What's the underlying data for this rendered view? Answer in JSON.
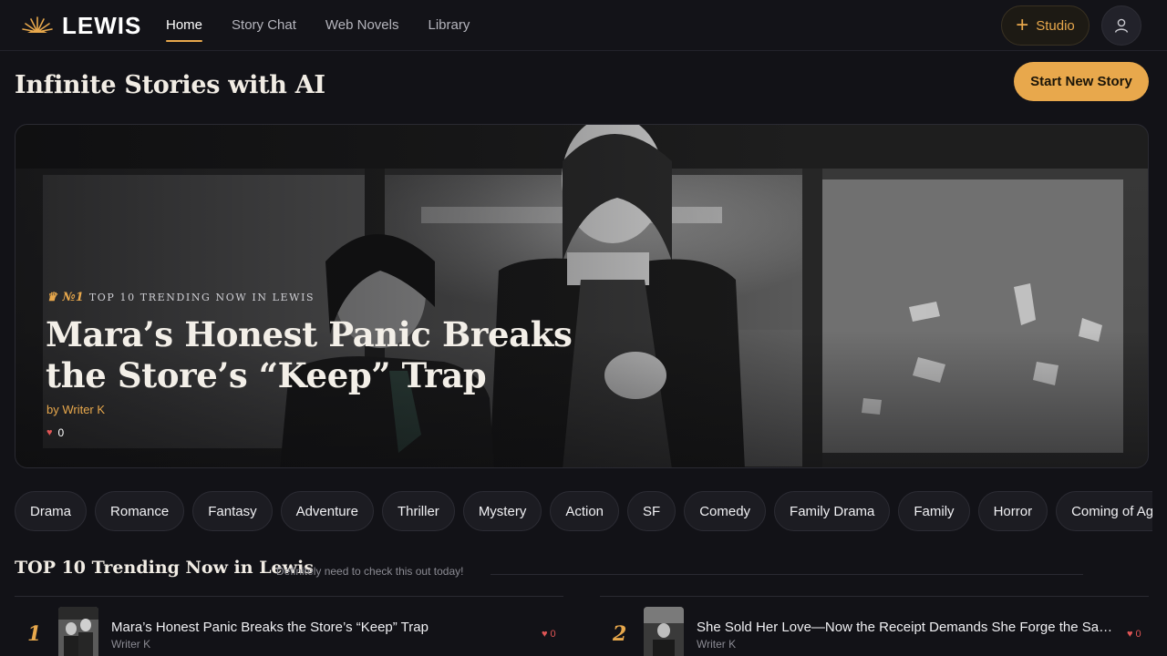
{
  "brand": {
    "name": "LEWIS",
    "accent": "#e8a84c"
  },
  "nav": {
    "links": [
      {
        "label": "Home",
        "active": true
      },
      {
        "label": "Story Chat",
        "active": false
      },
      {
        "label": "Web Novels",
        "active": false
      },
      {
        "label": "Library",
        "active": false
      }
    ],
    "studio_label": "Studio",
    "studio_icon": "plus-icon",
    "profile_icon": "user-icon"
  },
  "header": {
    "title": "Infinite Stories with AI",
    "start_label": "Start New Story"
  },
  "hero": {
    "rank": "№1",
    "rank_icon": "crown-icon",
    "kicker": "TOP 10 TRENDING NOW IN LEWIS",
    "title": "Mara’s Honest Panic Breaks the Store’s “Keep” Trap",
    "author": "by Writer K",
    "likes": "0"
  },
  "genres": [
    "Drama",
    "Romance",
    "Fantasy",
    "Adventure",
    "Thriller",
    "Mystery",
    "Action",
    "SF",
    "Comedy",
    "Family Drama",
    "Family",
    "Horror",
    "Coming of Age"
  ],
  "trending": {
    "title": "TOP 10 Trending Now in Lewis",
    "subtitle": "Definitely need to check this out today!",
    "items": [
      {
        "rank": "1",
        "title": "Mara’s Honest Panic Breaks the Store’s “Keep” Trap",
        "author": "Writer K",
        "likes": "0"
      },
      {
        "rank": "2",
        "title": "She Sold Her Love—Now the Receipt Demands She Forge the Same...",
        "author": "Writer K",
        "likes": "0"
      }
    ]
  }
}
